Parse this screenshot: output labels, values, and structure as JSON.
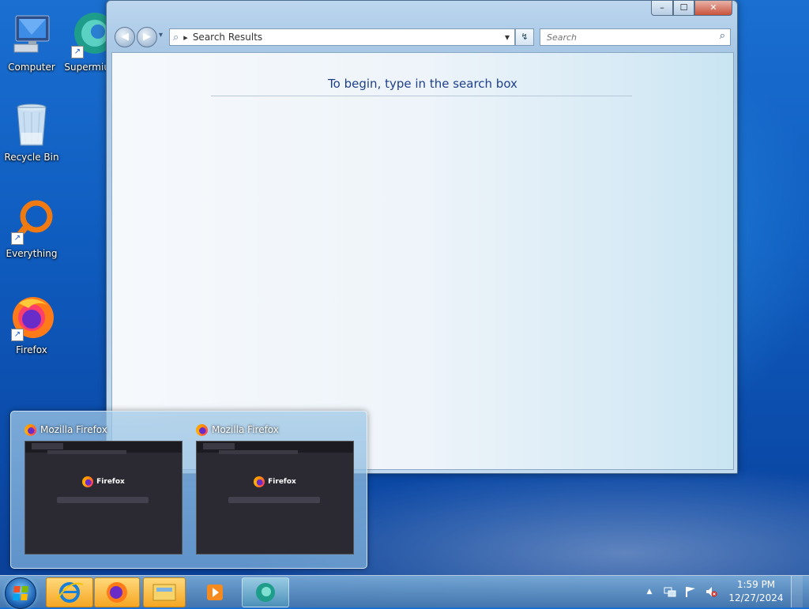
{
  "desktop": {
    "icons": [
      {
        "label": "Computer"
      },
      {
        "label": "Supermium"
      },
      {
        "label": "Recycle Bin"
      },
      {
        "label": "Everything"
      },
      {
        "label": "Firefox"
      }
    ]
  },
  "explorer": {
    "caption_buttons": {
      "minimize": "–",
      "maximize": "☐",
      "close": "✕"
    },
    "nav": {
      "back": "◀",
      "forward": "▶"
    },
    "address": {
      "arrow": "▸",
      "text": "Search Results",
      "dropdown": "▾"
    },
    "refresh": "↯",
    "search": {
      "placeholder": "Search",
      "icon": "⌕"
    },
    "message": "To begin, type in the search box"
  },
  "taskbar_previews": [
    {
      "title": "Mozilla Firefox",
      "brand": "Firefox"
    },
    {
      "title": "Mozilla Firefox",
      "brand": "Firefox"
    }
  ],
  "taskbar": {
    "pinned": [
      "internet-explorer",
      "firefox",
      "file-explorer",
      "media-player",
      "supermium"
    ]
  },
  "tray": {
    "chevron": "▲",
    "time": "1:59 PM",
    "date": "12/27/2024"
  }
}
